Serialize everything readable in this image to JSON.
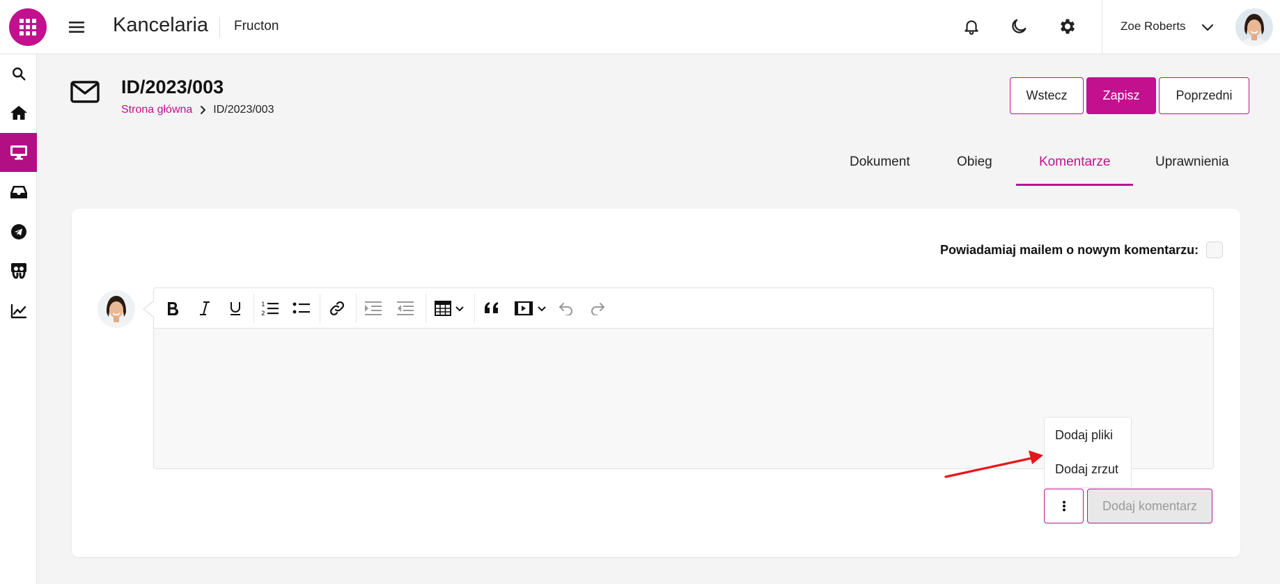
{
  "topbar": {
    "app_title": "Kancelaria",
    "org_name": "Fructon",
    "user_name": "Zoe Roberts"
  },
  "page": {
    "title": "ID/2023/003",
    "breadcrumb": {
      "home": "Strona główna",
      "current": "ID/2023/003"
    }
  },
  "actions": {
    "back": "Wstecz",
    "save": "Zapisz",
    "previous": "Poprzedni"
  },
  "tabs": [
    {
      "label": "Dokument"
    },
    {
      "label": "Obieg"
    },
    {
      "label": "Komentarze",
      "active": true
    },
    {
      "label": "Uprawnienia"
    }
  ],
  "comments": {
    "notify_label": "Powiadamiaj mailem o nowym komentarzu:",
    "notify_checked": false,
    "menu": {
      "add_files": "Dodaj pliki",
      "add_screenshot": "Dodaj zrzut"
    },
    "add_comment": "Dodaj komentarz"
  },
  "toolbar_icons": [
    "bold-icon",
    "italic-icon",
    "underline-icon",
    "numbered-list-icon",
    "bulleted-list-icon",
    "link-icon",
    "indent-icon",
    "outdent-icon",
    "table-icon",
    "blockquote-icon",
    "media-icon",
    "undo-icon",
    "redo-icon"
  ],
  "rail_icons": [
    "search-icon",
    "home-icon",
    "desktop-icon",
    "inbox-icon",
    "telegram-icon",
    "slideshare-icon",
    "chart-line-icon"
  ],
  "colors": {
    "accent": "#c2108f",
    "rail_active": "#b30f85",
    "annotation_arrow": "#e8141c"
  }
}
